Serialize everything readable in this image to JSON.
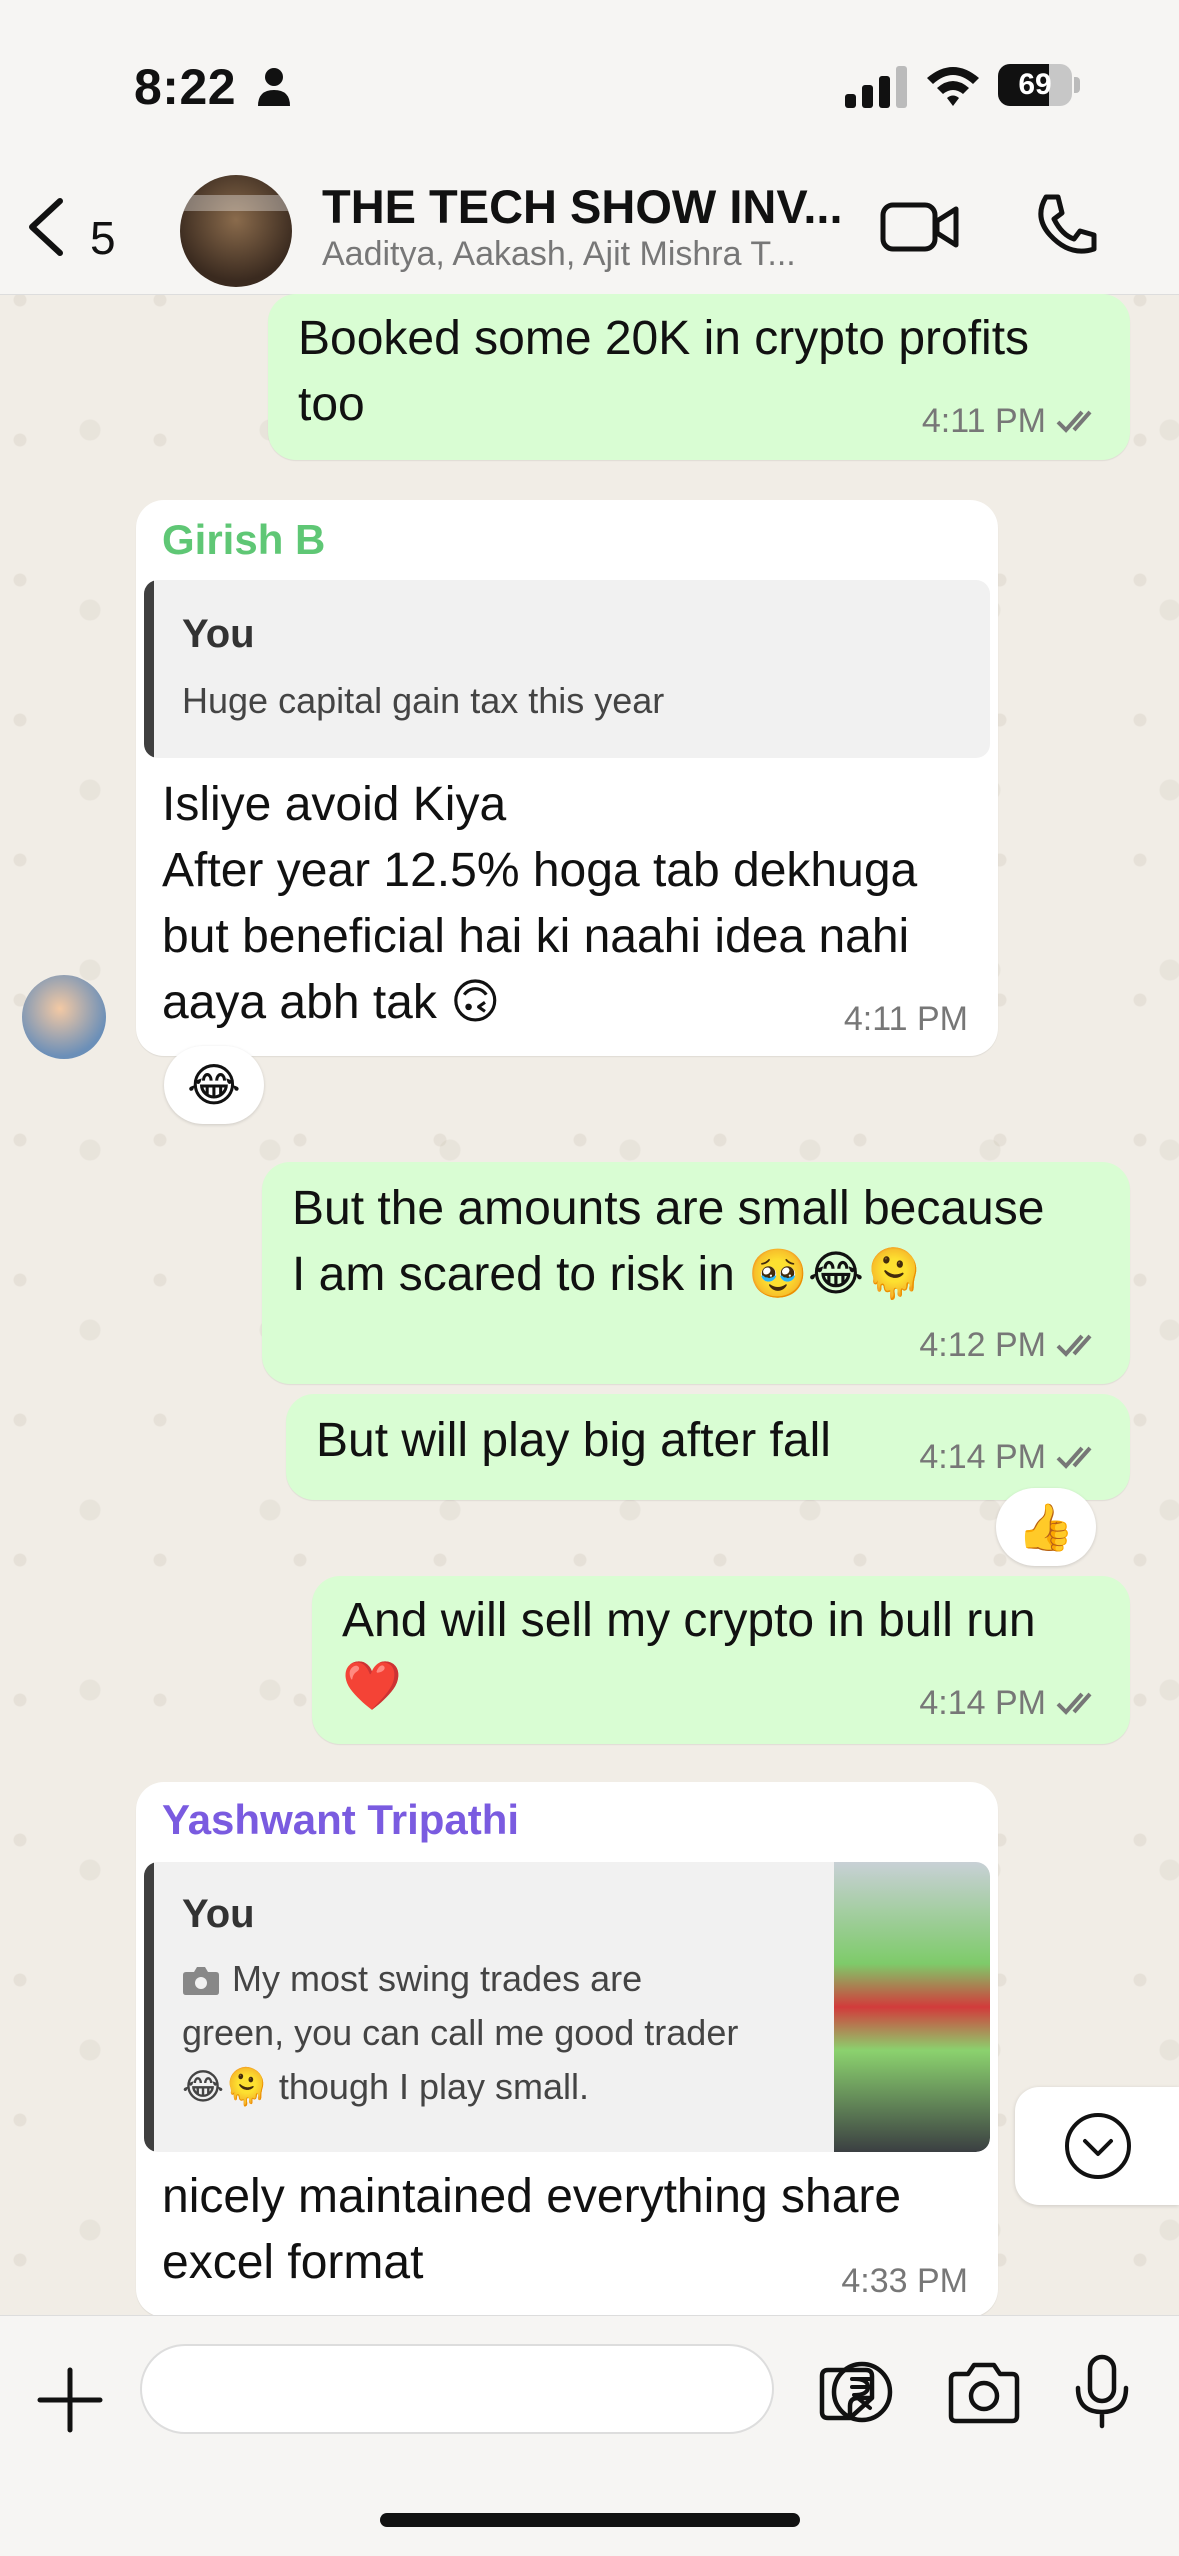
{
  "status_bar": {
    "time": "8:22",
    "battery_level": "69",
    "battery_fraction": 0.69
  },
  "header": {
    "back_count": "5",
    "group_name": "THE TECH SHOW INV...",
    "members": "Aaditya, Aakash, Ajit Mishra T...",
    "icons": [
      "chevron-left-icon",
      "video-call-icon",
      "phone-icon"
    ]
  },
  "messages": [
    {
      "direction": "out",
      "text": "Booked some 20K in crypto profits\ntoo",
      "time": "4:11 PM",
      "read": true
    },
    {
      "direction": "in",
      "sender": "Girish B",
      "sender_color": "#5fc775",
      "quote": {
        "author": "You",
        "text": "Huge capital gain tax this year"
      },
      "text": "Isliye avoid Kiya\nAfter year 12.5% hoga tab dekhuga\nbut beneficial hai ki naahi idea nahi\naaya abh tak 🙃",
      "time": "4:11 PM",
      "reaction": "😂"
    },
    {
      "direction": "out",
      "text": "But the amounts are small because\nI am scared to risk in 🥹😂🫠",
      "time": "4:12 PM",
      "read": true
    },
    {
      "direction": "out",
      "text": "But will play big after fall",
      "time": "4:14 PM",
      "read": true,
      "reaction": "👍"
    },
    {
      "direction": "out",
      "text": "And will sell my crypto in bull run\n❤️",
      "time": "4:14 PM",
      "read": true
    },
    {
      "direction": "in",
      "sender": "Yashwant Tripathi",
      "sender_color": "#7a5be0",
      "quote": {
        "author": "You",
        "text": "My most swing trades are\ngreen, you can call me good trader\n😂🫠 though I play small.",
        "has_photo_icon": true,
        "has_thumbnail": true
      },
      "text": "nicely maintained everything share\nexcel format",
      "time": "4:33 PM"
    }
  ],
  "composer": {
    "placeholder": "",
    "icons": [
      "plus-icon",
      "sticker-icon",
      "rupee-icon",
      "camera-icon",
      "microphone-icon"
    ]
  },
  "colors": {
    "outgoing_bubble": "#d9fdd3",
    "incoming_bubble": "#ffffff",
    "chat_background": "#efeae2"
  }
}
